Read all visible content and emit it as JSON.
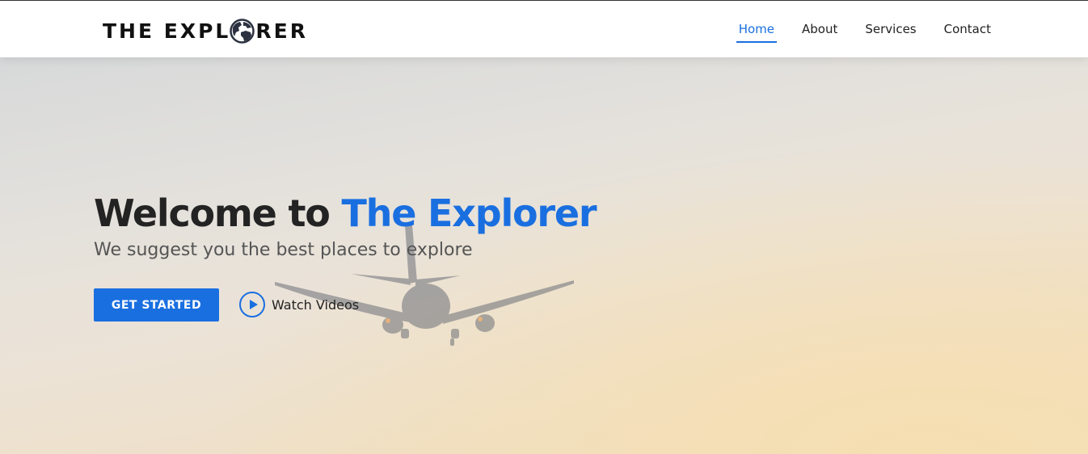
{
  "brand": {
    "logo_text_before": "THE EXPL",
    "logo_text_after": "RER",
    "logo_icon": "globe-icon"
  },
  "nav": {
    "items": [
      {
        "label": "Home",
        "active": true
      },
      {
        "label": "About",
        "active": false
      },
      {
        "label": "Services",
        "active": false
      },
      {
        "label": "Contact",
        "active": false
      }
    ]
  },
  "hero": {
    "headline_prefix": "Welcome to ",
    "headline_accent": "The Explorer",
    "subtitle": "We suggest you the best places to explore",
    "cta_label": "GET STARTED",
    "watch_label": "Watch Videos",
    "watch_icon": "play-icon",
    "background_image": "airplane-icon"
  },
  "colors": {
    "accent": "#1a6fe0",
    "text_dark": "#232323",
    "text_muted": "#555555"
  }
}
